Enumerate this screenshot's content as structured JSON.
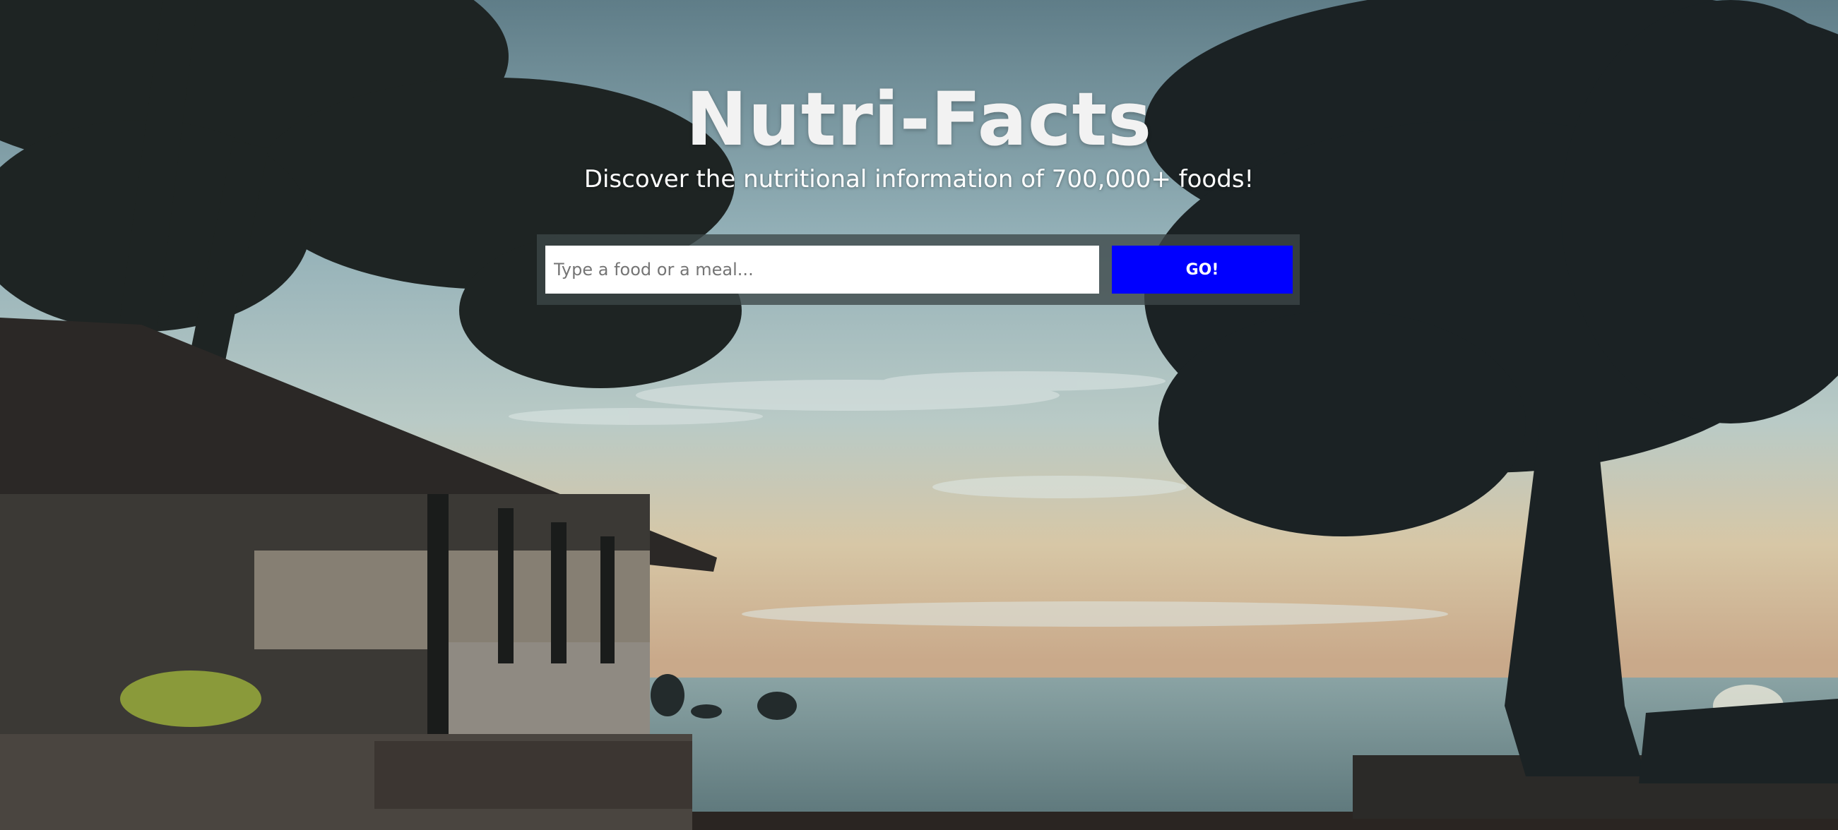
{
  "hero": {
    "title": "Nutri-Facts",
    "subtitle": "Discover the nutritional information of 700,000+ foods!"
  },
  "search": {
    "placeholder": "Type a food or a meal...",
    "value": "",
    "button_label": "GO!"
  },
  "background": {
    "description_icon": "beach-sunset-photo",
    "colors": {
      "sky_top": "#6f8f9a",
      "sky_mid": "#a9c4c8",
      "horizon": "#d9c9a8",
      "sea": "#6d8a8e",
      "silhouette": "#1b2224"
    }
  },
  "colors": {
    "title": "#f2f2f2",
    "button_bg": "#0000ff",
    "button_text": "#ffffff",
    "search_frame": "#3c4648"
  }
}
